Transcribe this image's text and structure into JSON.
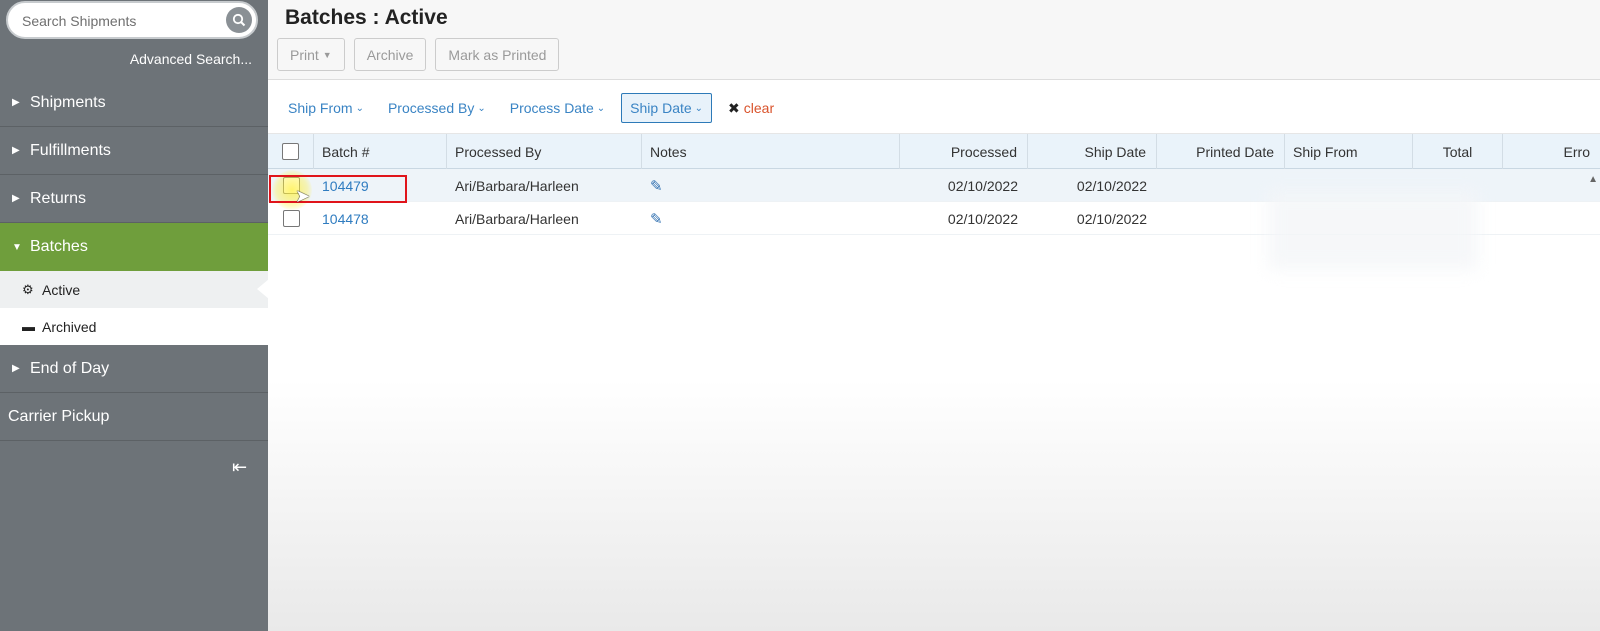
{
  "sidebar": {
    "search": {
      "placeholder": "Search Shipments"
    },
    "advanced_search": "Advanced Search...",
    "items": [
      {
        "label": "Shipments"
      },
      {
        "label": "Fulfillments"
      },
      {
        "label": "Returns"
      },
      {
        "label": "Batches"
      }
    ],
    "batches_sub": [
      {
        "label": "Active"
      },
      {
        "label": "Archived"
      }
    ],
    "end_of_day": "End of Day",
    "carrier_pickup": "Carrier Pickup"
  },
  "header": {
    "title": "Batches : Active",
    "buttons": {
      "print": "Print",
      "archive": "Archive",
      "mark_printed": "Mark as Printed"
    }
  },
  "filters": {
    "ship_from": "Ship From",
    "processed_by": "Processed By",
    "process_date": "Process Date",
    "ship_date": "Ship Date",
    "clear": "clear"
  },
  "table": {
    "columns": [
      "Batch #",
      "Processed By",
      "Notes",
      "Processed",
      "Ship Date",
      "Printed Date",
      "Ship From",
      "Total",
      "Erro"
    ],
    "rows": [
      {
        "batch": "104479",
        "processed_by": "Ari/Barbara/Harleen",
        "processed": "02/10/2022",
        "ship_date": "02/10/2022"
      },
      {
        "batch": "104478",
        "processed_by": "Ari/Barbara/Harleen",
        "processed": "02/10/2022",
        "ship_date": "02/10/2022"
      }
    ]
  },
  "colors": {
    "accent_green": "#6f9e3c",
    "sidebar": "#6d7378",
    "link": "#2f7cc0",
    "clear": "#d9532c",
    "highlight": "#e0141b"
  }
}
